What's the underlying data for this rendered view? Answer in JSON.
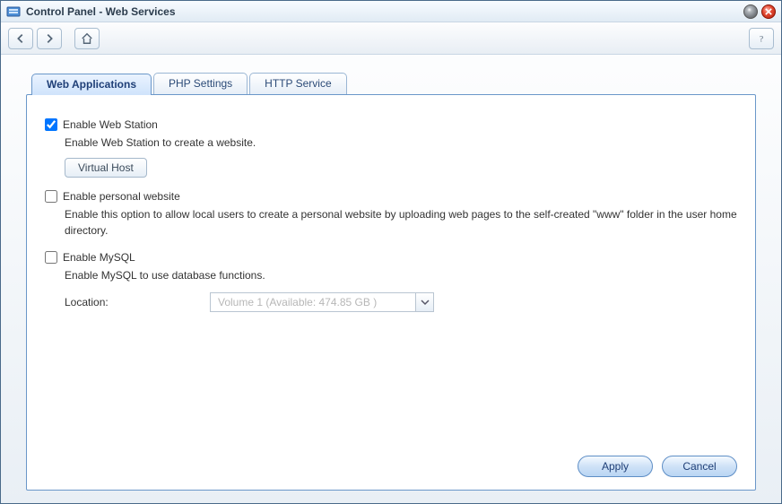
{
  "window": {
    "title": "Control Panel - Web Services"
  },
  "tabs": {
    "web_applications": "Web Applications",
    "php_settings": "PHP Settings",
    "http_service": "HTTP Service"
  },
  "options": {
    "web_station": {
      "label": "Enable Web Station",
      "checked": true,
      "description": "Enable Web Station to create a website.",
      "virtual_host_btn": "Virtual Host"
    },
    "personal_website": {
      "label": "Enable personal website",
      "checked": false,
      "description": "Enable this option to allow local users to create a personal website by uploading web pages to the self-created \"www\" folder in the user home directory."
    },
    "mysql": {
      "label": "Enable MySQL",
      "checked": false,
      "description": "Enable MySQL to use database functions.",
      "location_label": "Location:",
      "location_value": "Volume 1 (Available: 474.85 GB )"
    }
  },
  "buttons": {
    "apply": "Apply",
    "cancel": "Cancel"
  }
}
